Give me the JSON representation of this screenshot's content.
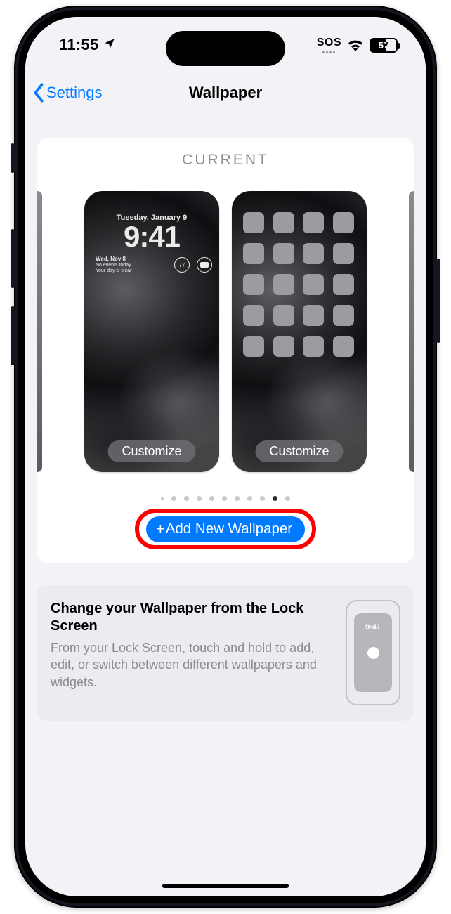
{
  "status": {
    "time": "11:55",
    "sos": "SOS",
    "battery_pct": "57"
  },
  "nav": {
    "back_label": "Settings",
    "title": "Wallpaper"
  },
  "current_section": {
    "title": "CURRENT",
    "lock_preview": {
      "date": "Tuesday, January 9",
      "time": "9:41",
      "wday": "Wed, Nov 8",
      "wline1": "No events today",
      "wline2": "Your day is clear",
      "temp": "77",
      "customize_label": "Customize"
    },
    "home_preview": {
      "customize_label": "Customize"
    },
    "add_button_label": "Add New Wallpaper"
  },
  "info": {
    "title": "Change your Wallpaper from the Lock Screen",
    "body": "From your Lock Screen, touch and hold to add, edit, or switch between different wallpapers and widgets.",
    "ill_time": "9:41"
  }
}
